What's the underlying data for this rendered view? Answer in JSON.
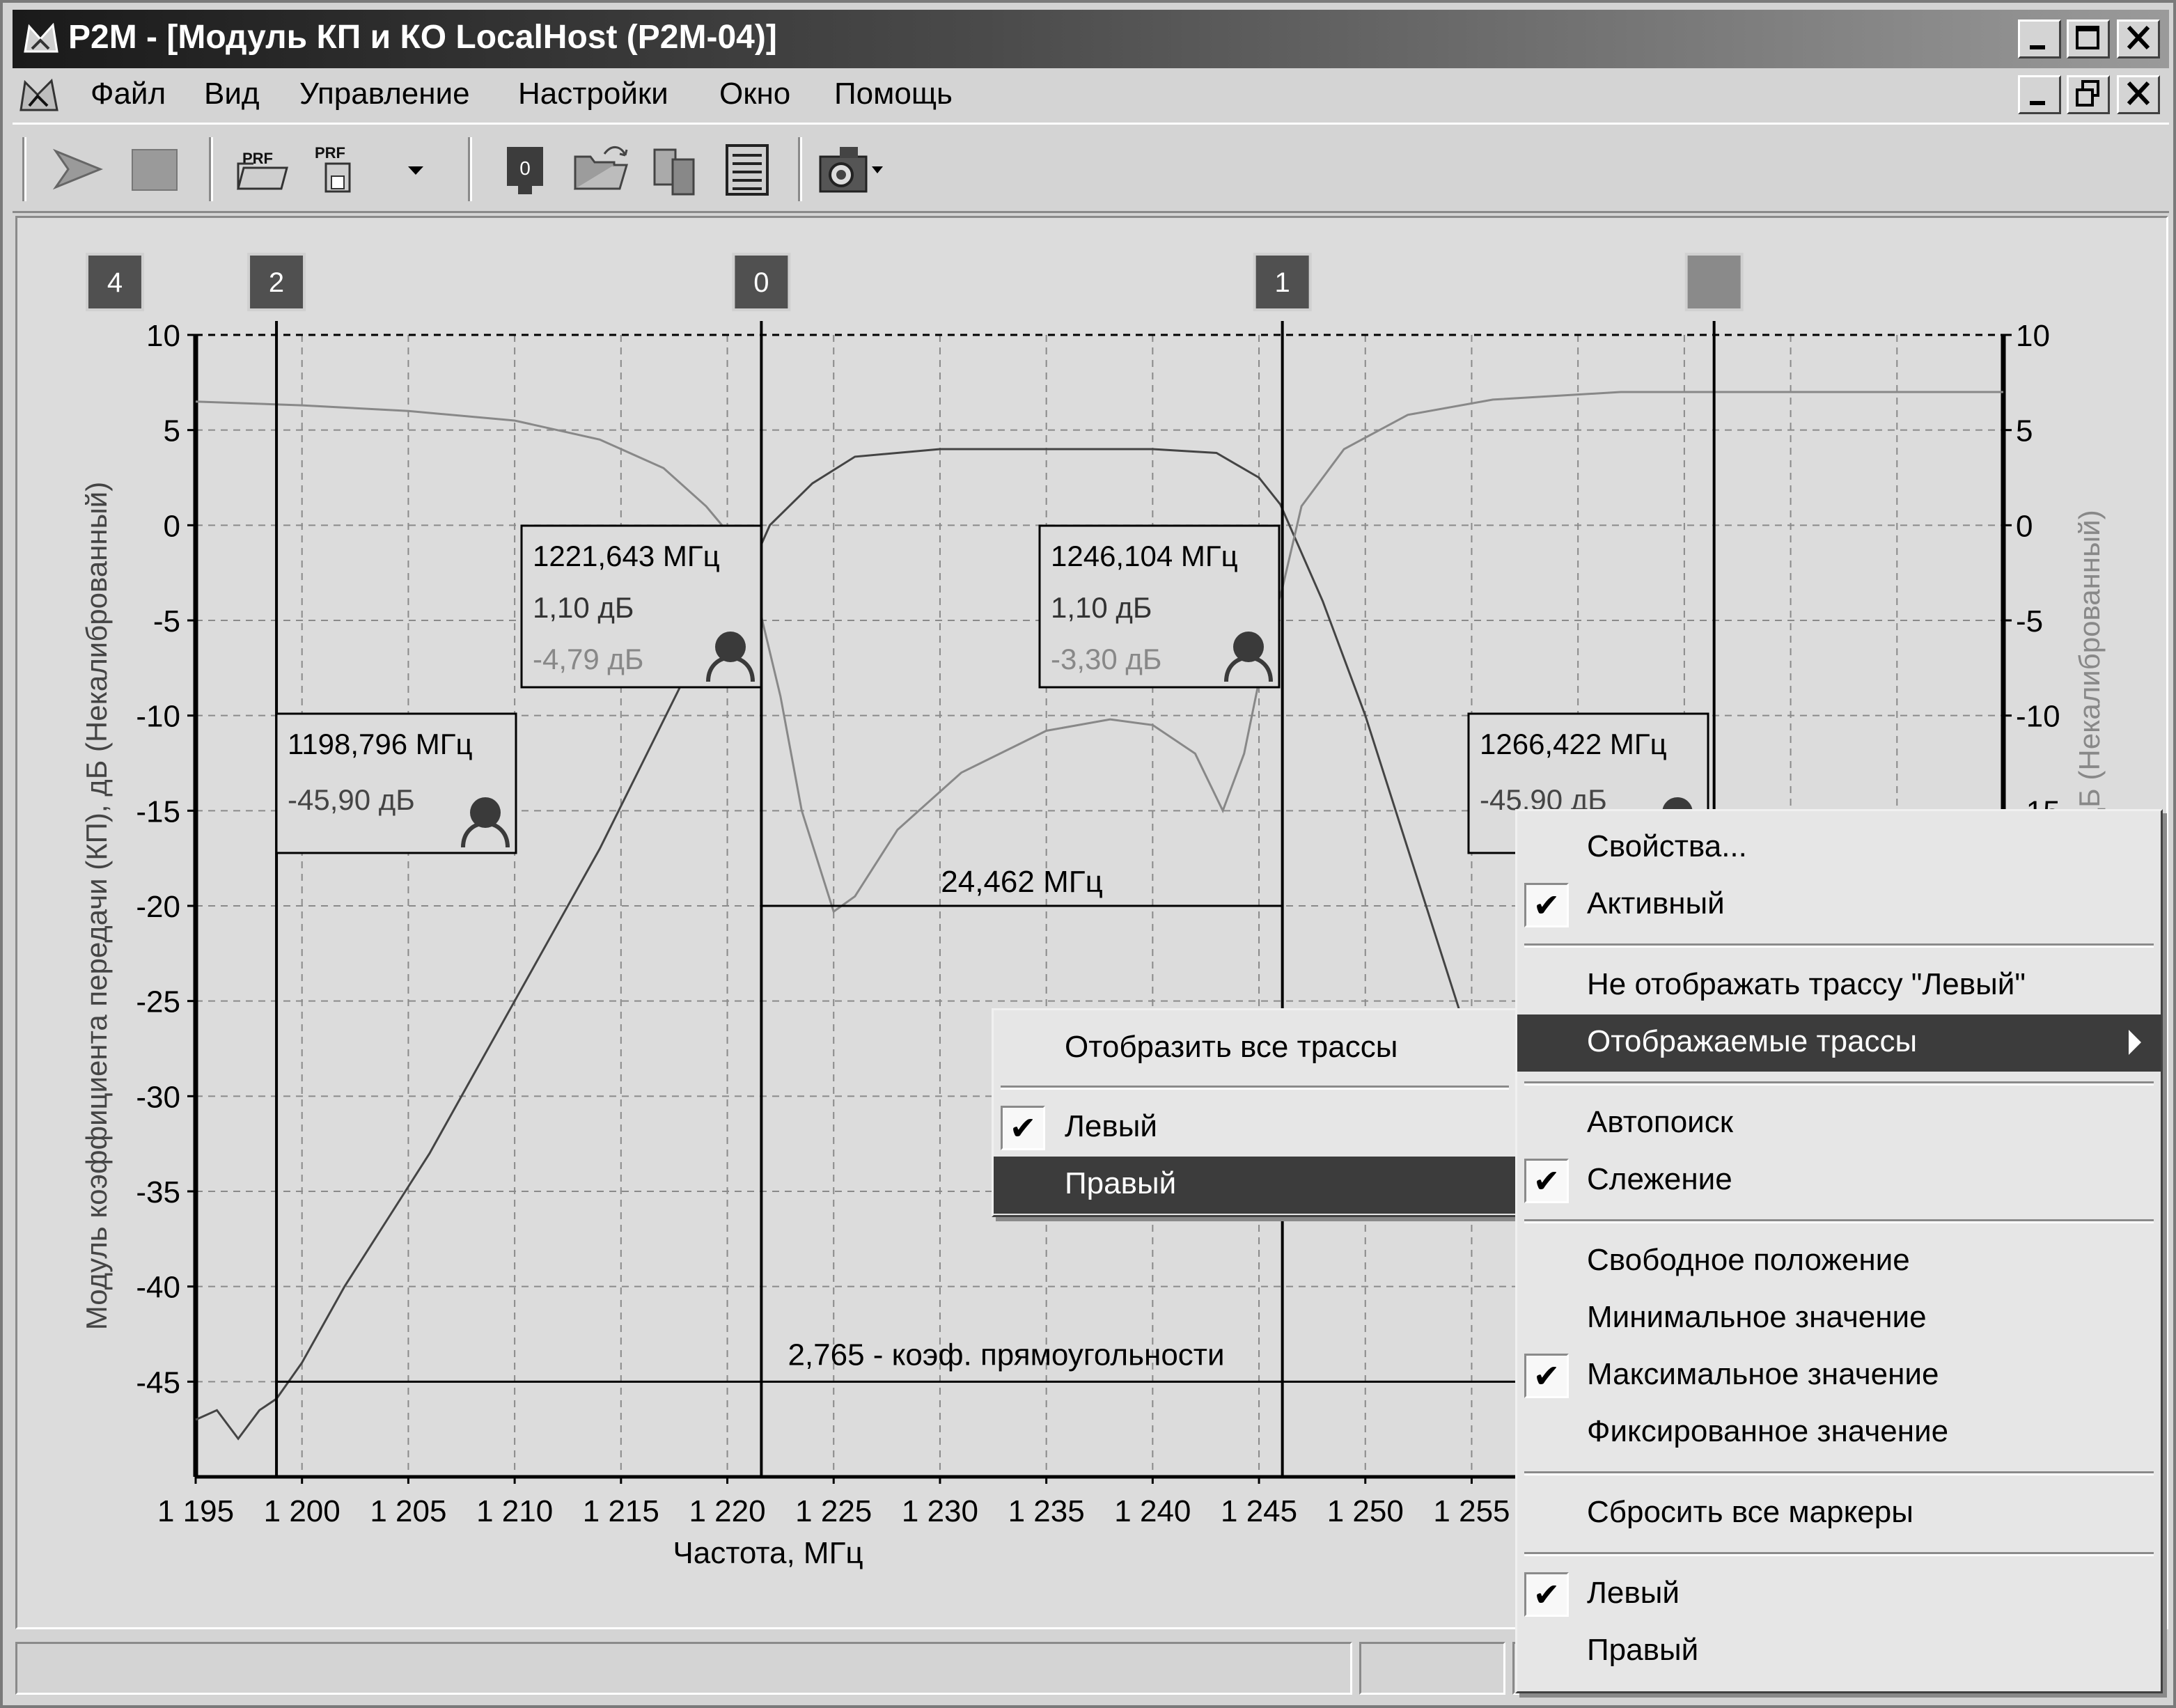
{
  "window": {
    "title": "P2M - [Модуль КП и КО LocalHost (P2M-04)]"
  },
  "menubar": [
    "Файл",
    "Вид",
    "Управление",
    "Настройки",
    "Окно",
    "Помощь"
  ],
  "toolbar": {
    "prf_label_1": "PRF",
    "prf_label_2": "PRF",
    "marker0_label": "0"
  },
  "chart_data": {
    "type": "line",
    "xlabel": "Частота, МГц",
    "ylabel_left": "Модуль коэффициента передачи (КП), дБ  (Некалиброванный)",
    "ylabel_right": "), дБ (Некалиброванный)",
    "x_ticks": [
      "1 195",
      "1 200",
      "1 205",
      "1 210",
      "1 215",
      "1 220",
      "1 225",
      "1 230",
      "1 235",
      "1 240",
      "1 245",
      "1 250",
      "1 255"
    ],
    "x_tick_values": [
      1195,
      1200,
      1205,
      1210,
      1215,
      1220,
      1225,
      1230,
      1235,
      1240,
      1245,
      1250,
      1255
    ],
    "y_ticks_left": [
      "10",
      "5",
      "0",
      "-5",
      "-10",
      "-15",
      "-20",
      "-25",
      "-30",
      "-35",
      "-40",
      "-45"
    ],
    "y_tick_values": [
      10,
      5,
      0,
      -5,
      -10,
      -15,
      -20,
      -25,
      -30,
      -35,
      -40,
      -45
    ],
    "y_ticks_right": [
      "10",
      "5",
      "0",
      "-5",
      "-10",
      "-15"
    ],
    "xlim": [
      1195,
      1280
    ],
    "ylim": [
      -50,
      10
    ],
    "grid": true,
    "series": [
      {
        "color": "#444444",
        "x": [
          1195,
          1196,
          1197,
          1198,
          1198.8,
          1200,
          1202,
          1204,
          1206,
          1208,
          1210,
          1212,
          1214,
          1216,
          1218,
          1220,
          1221.6,
          1222,
          1224,
          1226,
          1230,
          1235,
          1240,
          1243,
          1245,
          1246,
          1248,
          1250,
          1252,
          1254,
          1256,
          1258,
          1260,
          1262,
          1264,
          1266.4
        ],
        "y": [
          -47,
          -46.5,
          -48,
          -46.5,
          -45.9,
          -44,
          -40,
          -36.5,
          -33,
          -29,
          -25,
          -21,
          -17,
          -12.5,
          -8,
          -3.5,
          -1,
          0,
          2.2,
          3.6,
          4,
          4,
          4,
          3.8,
          2.5,
          1.1,
          -4,
          -10,
          -17,
          -24,
          -31,
          -38,
          -44,
          -45,
          -45.5,
          -45.9
        ]
      },
      {
        "color": "#888888",
        "x": [
          1195,
          1200,
          1205,
          1210,
          1214,
          1217,
          1219,
          1220.5,
          1221.6,
          1222.5,
          1223.5,
          1225,
          1226,
          1228,
          1231,
          1235,
          1238,
          1240,
          1242,
          1243.3,
          1244.3,
          1245.4,
          1246.1,
          1247,
          1249,
          1252,
          1256,
          1262,
          1270,
          1280
        ],
        "y": [
          6.5,
          6.3,
          6,
          5.5,
          4.5,
          3,
          1,
          -1,
          -4.8,
          -9,
          -15,
          -20.3,
          -19.5,
          -16,
          -13,
          -10.8,
          -10.2,
          -10.5,
          -12,
          -15,
          -12,
          -6,
          -3.3,
          1,
          4,
          5.8,
          6.6,
          7,
          7,
          7
        ]
      }
    ],
    "vertical_markers": [
      {
        "label": "4",
        "x": 1191.2,
        "line": false
      },
      {
        "label": "2",
        "x": 1198.8,
        "line": true
      },
      {
        "label": "0",
        "x": 1221.6,
        "line": true
      },
      {
        "label": "1",
        "x": 1246.1,
        "line": true
      },
      {
        "label": "",
        "x": 1266.4,
        "line": true
      }
    ],
    "marker_boxes": [
      {
        "freq": "1198,796 МГц",
        "v1": "-45,90 дБ",
        "v2": ""
      },
      {
        "freq": "1221,643 МГц",
        "v1": "1,10 дБ",
        "v2": "-4,79 дБ"
      },
      {
        "freq": "1246,104 МГц",
        "v1": "1,10 дБ",
        "v2": "-3,30 дБ"
      },
      {
        "freq": "1266,422 МГц",
        "v1": "-45,90 дБ",
        "v2": ""
      }
    ],
    "bandwidth_label": "24,462 МГц",
    "bandwidth_y": -20,
    "shape_factor_label": "2,765 - коэф. прямоугольности",
    "shape_factor_y": -45
  },
  "context_menu": {
    "properties": "Свойства...",
    "active": "Активный",
    "hide_trace": "Не отображать трассу \"Левый\"",
    "shown_traces": "Отображаемые трассы",
    "autosearch": "Автопоиск",
    "tracking": "Слежение",
    "free_position": "Свободное положение",
    "min_value": "Минимальное значение",
    "max_value": "Максимальное значение",
    "fixed_value": "Фиксированное значение",
    "reset_markers": "Сбросить все маркеры",
    "left": "Левый",
    "right": "Правый",
    "check": "✔"
  },
  "submenu": {
    "show_all": "Отобразить все трассы",
    "left": "Левый",
    "right": "Правый"
  }
}
